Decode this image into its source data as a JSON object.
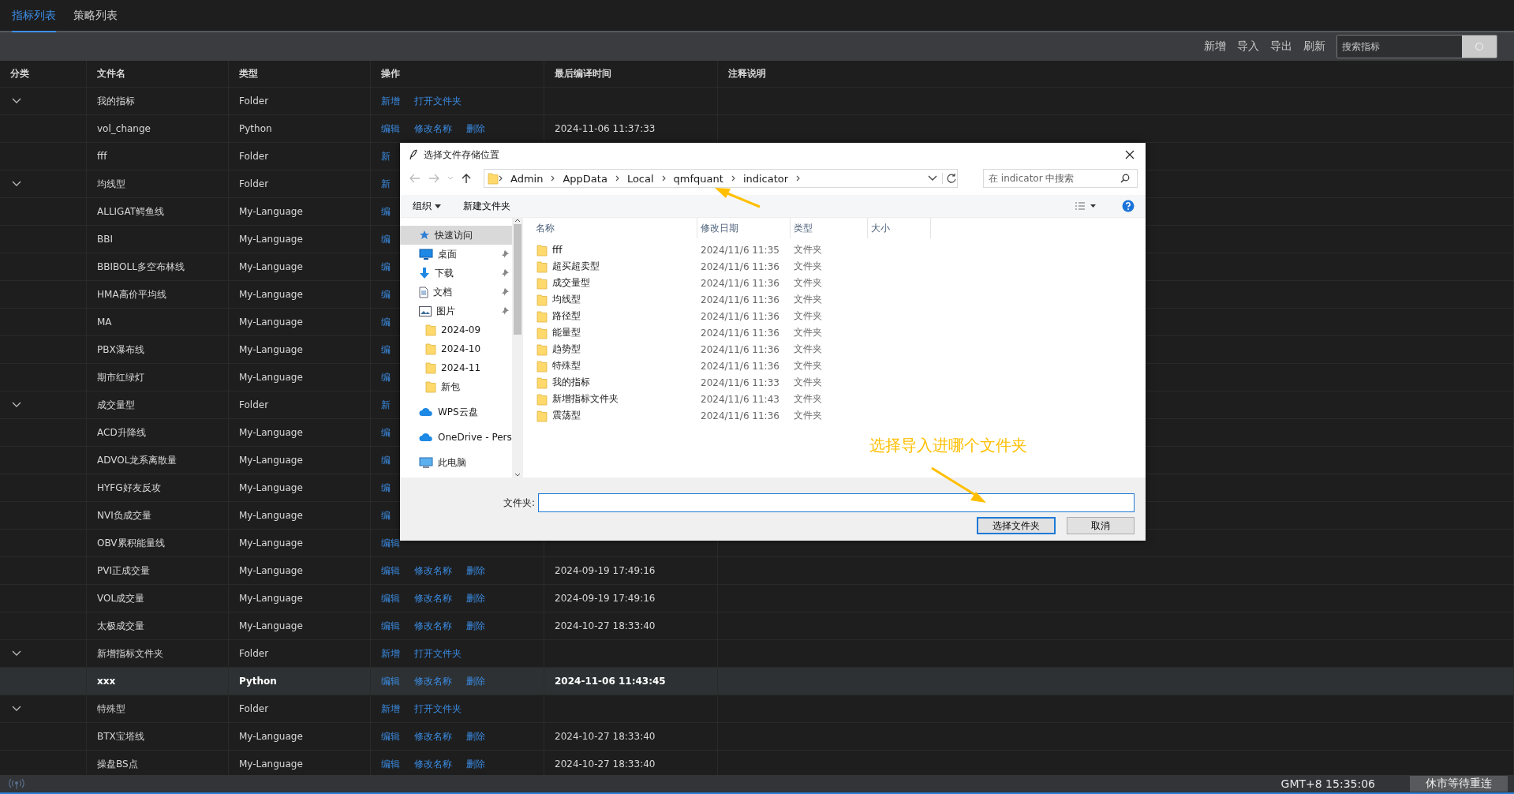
{
  "tabs": [
    {
      "label": "指标列表",
      "selected": true
    },
    {
      "label": "策略列表",
      "selected": false
    }
  ],
  "toolbar": {
    "actions": [
      "新增",
      "导入",
      "导出",
      "刷新"
    ],
    "search": {
      "placeholder": "搜索指标"
    }
  },
  "table": {
    "columns": [
      "分类",
      "文件名",
      "类型",
      "操作",
      "最后编译时间",
      "注释说明"
    ],
    "rows": [
      {
        "name": "我的指标",
        "type": "Folder",
        "expanded": true,
        "selected": false,
        "actions": [
          "新增",
          "打开文件夹"
        ]
      },
      {
        "name": "vol_change",
        "type": "Python",
        "selected": false,
        "actions": [
          "编辑",
          "修改名称",
          "删除"
        ],
        "time": "2024-11-06 11:37:33"
      },
      {
        "name": "fff",
        "type": "Folder",
        "selected": false,
        "actions": [
          "新"
        ]
      },
      {
        "name": "均线型",
        "type": "Folder",
        "expanded": true,
        "selected": false,
        "actions": [
          "新"
        ]
      },
      {
        "name": "ALLIGAT鳄鱼线",
        "type": "My-Language",
        "selected": false,
        "actions": [
          "编"
        ]
      },
      {
        "name": "BBI",
        "type": "My-Language",
        "selected": false,
        "actions": [
          "编"
        ]
      },
      {
        "name": "BBIBOLL多空布林线",
        "type": "My-Language",
        "selected": false,
        "actions": [
          "编"
        ]
      },
      {
        "name": "HMA高价平均线",
        "type": "My-Language",
        "selected": false,
        "actions": [
          "编"
        ]
      },
      {
        "name": "MA",
        "type": "My-Language",
        "selected": false,
        "actions": [
          "编"
        ]
      },
      {
        "name": "PBX瀑布线",
        "type": "My-Language",
        "selected": false,
        "actions": [
          "编"
        ]
      },
      {
        "name": "期市红绿灯",
        "type": "My-Language",
        "selected": false,
        "actions": [
          "编"
        ]
      },
      {
        "name": "成交量型",
        "type": "Folder",
        "expanded": true,
        "selected": false,
        "actions": [
          "新"
        ]
      },
      {
        "name": "ACD升降线",
        "type": "My-Language",
        "selected": false,
        "actions": [
          "编"
        ]
      },
      {
        "name": "ADVOL龙系离散量",
        "type": "My-Language",
        "selected": false,
        "actions": [
          "编"
        ]
      },
      {
        "name": "HYFG好友反攻",
        "type": "My-Language",
        "selected": false,
        "actions": [
          "编"
        ]
      },
      {
        "name": "NVI负成交量",
        "type": "My-Language",
        "selected": false,
        "actions": [
          "编"
        ]
      },
      {
        "name": "OBV累积能量线",
        "type": "My-Language",
        "selected": false,
        "actions": [
          "编辑"
        ]
      },
      {
        "name": "PVI正成交量",
        "type": "My-Language",
        "selected": false,
        "actions": [
          "编辑",
          "修改名称",
          "删除"
        ],
        "time": "2024-09-19 17:49:16"
      },
      {
        "name": "VOL成交量",
        "type": "My-Language",
        "selected": false,
        "actions": [
          "编辑",
          "修改名称",
          "删除"
        ],
        "time": "2024-09-19 17:49:16"
      },
      {
        "name": "太极成交量",
        "type": "My-Language",
        "selected": false,
        "actions": [
          "编辑",
          "修改名称",
          "删除"
        ],
        "time": "2024-10-27 18:33:40"
      },
      {
        "name": "新增指标文件夹",
        "type": "Folder",
        "expanded": true,
        "selected": false,
        "actions": [
          "新增",
          "打开文件夹"
        ]
      },
      {
        "name": "xxx",
        "type": "Python",
        "selected": true,
        "actions": [
          "编辑",
          "修改名称",
          "删除"
        ],
        "time": "2024-11-06 11:43:45"
      },
      {
        "name": "特殊型",
        "type": "Folder",
        "expanded": true,
        "selected": false,
        "actions": [
          "新增",
          "打开文件夹"
        ]
      },
      {
        "name": "BTX宝塔线",
        "type": "My-Language",
        "selected": false,
        "actions": [
          "编辑",
          "修改名称",
          "删除"
        ],
        "time": "2024-10-27 18:33:40"
      },
      {
        "name": "操盘BS点",
        "type": "My-Language",
        "selected": false,
        "actions": [
          "编辑",
          "修改名称",
          "删除"
        ],
        "time": "2024-10-27 18:33:40"
      }
    ]
  },
  "dialog": {
    "title": "选择文件存储位置",
    "path": [
      "Admin",
      "AppData",
      "Local",
      "qmfquant",
      "indicator"
    ],
    "search": {
      "placeholder": "在 indicator 中搜索"
    },
    "commands": [
      "组织",
      "新建文件夹"
    ],
    "nav": [
      {
        "label": "快速访问",
        "kind": "star",
        "selected": true,
        "pinned": false
      },
      {
        "label": "桌面",
        "kind": "desktop",
        "selected": false,
        "pinned": true
      },
      {
        "label": "下载",
        "kind": "download",
        "selected": false,
        "pinned": true
      },
      {
        "label": "文档",
        "kind": "document",
        "selected": false,
        "pinned": true
      },
      {
        "label": "图片",
        "kind": "image",
        "selected": false,
        "pinned": true
      },
      {
        "label": "2024-09",
        "kind": "folder",
        "selected": false,
        "pinned": false
      },
      {
        "label": "2024-10",
        "kind": "folder",
        "selected": false,
        "pinned": false
      },
      {
        "label": "2024-11",
        "kind": "folder",
        "selected": false,
        "pinned": false
      },
      {
        "label": "新包",
        "kind": "folder",
        "selected": false,
        "pinned": false
      },
      {
        "label": "WPS云盘",
        "kind": "cloud",
        "selected": false,
        "pinned": false
      },
      {
        "label": "OneDrive - Pers",
        "kind": "cloud",
        "selected": false,
        "pinned": false
      },
      {
        "label": "此电脑",
        "kind": "computer",
        "selected": false,
        "pinned": false
      }
    ],
    "columns": [
      "名称",
      "修改日期",
      "类型",
      "大小"
    ],
    "files": [
      {
        "name": "fff",
        "modified": "2024/11/6 11:35",
        "type": "文件夹"
      },
      {
        "name": "超买超卖型",
        "modified": "2024/11/6 11:36",
        "type": "文件夹"
      },
      {
        "name": "成交量型",
        "modified": "2024/11/6 11:36",
        "type": "文件夹"
      },
      {
        "name": "均线型",
        "modified": "2024/11/6 11:36",
        "type": "文件夹"
      },
      {
        "name": "路径型",
        "modified": "2024/11/6 11:36",
        "type": "文件夹"
      },
      {
        "name": "能量型",
        "modified": "2024/11/6 11:36",
        "type": "文件夹"
      },
      {
        "name": "趋势型",
        "modified": "2024/11/6 11:36",
        "type": "文件夹"
      },
      {
        "name": "特殊型",
        "modified": "2024/11/6 11:36",
        "type": "文件夹"
      },
      {
        "name": "我的指标",
        "modified": "2024/11/6 11:33",
        "type": "文件夹"
      },
      {
        "name": "新增指标文件夹",
        "modified": "2024/11/6 11:43",
        "type": "文件夹"
      },
      {
        "name": "震荡型",
        "modified": "2024/11/6 11:36",
        "type": "文件夹"
      }
    ],
    "folder_label": "文件夹:",
    "buttons": [
      "选择文件夹",
      "取消"
    ]
  },
  "annotation": {
    "text": "选择导入进哪个文件夹"
  },
  "status_bar": {
    "time": "GMT+8 15:35:06",
    "status": "休市等待重连"
  }
}
